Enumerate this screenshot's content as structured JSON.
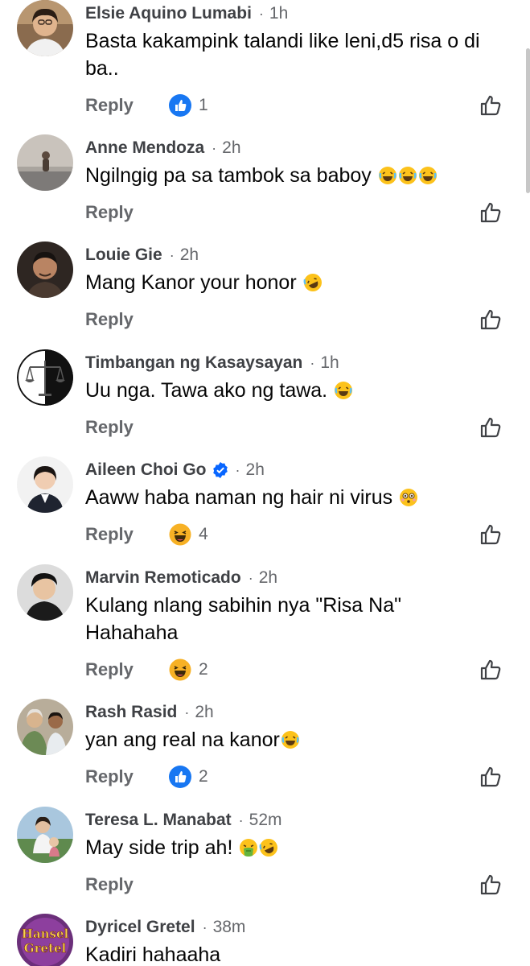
{
  "comments": [
    {
      "author": "Elsie Aquino Lumabi",
      "time": "1h",
      "text": "Basta kakampink talandi like leni,d5 risa o di ba..",
      "emojis": [],
      "reply": "Reply",
      "reaction": "like",
      "reaction_count": "1",
      "verified": false,
      "avatar": "avatar-elsie"
    },
    {
      "author": "Anne Mendoza",
      "time": "2h",
      "text": "Ngilngig pa sa tambok sa baboy",
      "emojis": [
        "joy",
        "joy",
        "joy"
      ],
      "reply": "Reply",
      "reaction": null,
      "reaction_count": "",
      "verified": false,
      "avatar": "avatar-anne"
    },
    {
      "author": "Louie Gie",
      "time": "2h",
      "text": "Mang Kanor your honor",
      "emojis": [
        "rofl"
      ],
      "reply": "Reply",
      "reaction": null,
      "reaction_count": "",
      "verified": false,
      "avatar": "avatar-louie"
    },
    {
      "author": "Timbangan ng Kasaysayan",
      "time": "1h",
      "text": "Uu nga. Tawa ako ng tawa.",
      "emojis": [
        "joy"
      ],
      "reply": "Reply",
      "reaction": null,
      "reaction_count": "",
      "verified": false,
      "avatar": "avatar-scales"
    },
    {
      "author": "Aileen Choi Go",
      "time": "2h",
      "text": "Aaww haba naman ng hair ni virus",
      "emojis": [
        "flushed"
      ],
      "reply": "Reply",
      "reaction": "haha",
      "reaction_count": "4",
      "verified": true,
      "avatar": "avatar-aileen"
    },
    {
      "author": "Marvin Remoticado",
      "time": "2h",
      "text": "Kulang nlang sabihin nya \"Risa Na\" Hahahaha",
      "emojis": [],
      "reply": "Reply",
      "reaction": "haha",
      "reaction_count": "2",
      "verified": false,
      "avatar": "avatar-marvin"
    },
    {
      "author": "Rash Rasid",
      "time": "2h",
      "text": "yan ang real na kanor",
      "emojis": [
        "joy"
      ],
      "reply": "Reply",
      "reaction": "like",
      "reaction_count": "2",
      "verified": false,
      "avatar": "avatar-rash"
    },
    {
      "author": "Teresa L. Manabat",
      "time": "52m",
      "text": "May side trip ah!",
      "emojis": [
        "vomit",
        "rofl"
      ],
      "reply": "Reply",
      "reaction": null,
      "reaction_count": "",
      "verified": false,
      "avatar": "avatar-teresa"
    },
    {
      "author": "Dyricel Gretel",
      "time": "38m",
      "text": "Kadiri hahaaha",
      "emojis": [],
      "reply": "Reply",
      "reaction": null,
      "reaction_count": "",
      "verified": false,
      "avatar": "avatar-hansel-gretel",
      "avatar_text": [
        "Hansel",
        "Gretel"
      ]
    }
  ],
  "colors": {
    "name": "#3f4145",
    "meta": "#65676b",
    "text": "#050505",
    "like_blue": "#1877f2",
    "haha_yellow": "#f7b125",
    "verified_blue": "#0866ff"
  }
}
